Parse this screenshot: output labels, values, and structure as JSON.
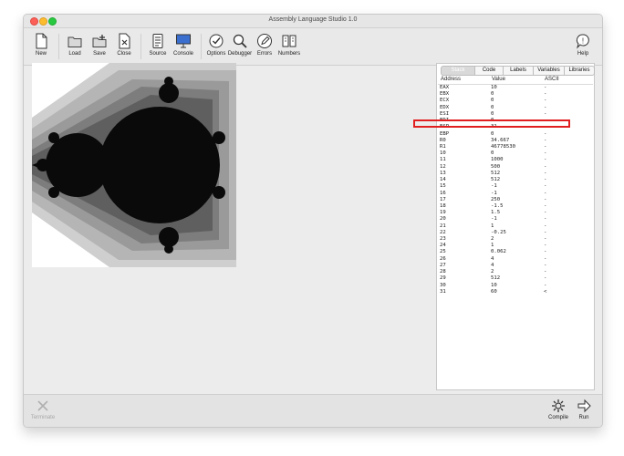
{
  "window": {
    "title": "Assembly Language Studio 1.0"
  },
  "toolbar": {
    "new": "New",
    "load": "Load",
    "save": "Save",
    "close": "Close",
    "source": "Source",
    "console": "Console",
    "options": "Options",
    "debugger": "Debugger",
    "errors": "Errors",
    "numbers": "Numbers",
    "help": "Help"
  },
  "panel": {
    "tabs": [
      "Stack",
      "Code",
      "Labels",
      "Variables",
      "Libraries"
    ],
    "active_tab": "Stack",
    "columns": {
      "address": "Address",
      "value": "Value",
      "ascii": "ASCII"
    },
    "rows": [
      {
        "address": "EAX",
        "value": "10",
        "ascii": "-"
      },
      {
        "address": "EBX",
        "value": "0",
        "ascii": "-"
      },
      {
        "address": "ECX",
        "value": "0",
        "ascii": "-"
      },
      {
        "address": "EDX",
        "value": "0",
        "ascii": "-"
      },
      {
        "address": "ESI",
        "value": "0",
        "ascii": "-"
      },
      {
        "address": "EDI",
        "value": "0",
        "ascii": "-"
      },
      {
        "address": "ESP",
        "value": "31",
        "ascii": "-"
      },
      {
        "address": "EBP",
        "value": "0",
        "ascii": "-"
      },
      {
        "address": "R0",
        "value": "34.667",
        "ascii": "-"
      },
      {
        "address": "R1",
        "value": "46778530",
        "ascii": "-"
      },
      {
        "address": "10",
        "value": "0",
        "ascii": "-"
      },
      {
        "address": "11",
        "value": "1000",
        "ascii": "-"
      },
      {
        "address": "12",
        "value": "500",
        "ascii": "-"
      },
      {
        "address": "13",
        "value": "512",
        "ascii": "-"
      },
      {
        "address": "14",
        "value": "512",
        "ascii": "-"
      },
      {
        "address": "15",
        "value": "-1",
        "ascii": "-"
      },
      {
        "address": "16",
        "value": "-1",
        "ascii": "-"
      },
      {
        "address": "17",
        "value": "250",
        "ascii": "-"
      },
      {
        "address": "18",
        "value": "-1.5",
        "ascii": "-"
      },
      {
        "address": "19",
        "value": "1.5",
        "ascii": "-"
      },
      {
        "address": "20",
        "value": "-1",
        "ascii": "-"
      },
      {
        "address": "21",
        "value": "1",
        "ascii": "-"
      },
      {
        "address": "22",
        "value": "-0.25",
        "ascii": "-"
      },
      {
        "address": "23",
        "value": "2",
        "ascii": "-"
      },
      {
        "address": "24",
        "value": "1",
        "ascii": "-"
      },
      {
        "address": "25",
        "value": "0.062",
        "ascii": "-"
      },
      {
        "address": "26",
        "value": "4",
        "ascii": "-"
      },
      {
        "address": "27",
        "value": "4",
        "ascii": "-"
      },
      {
        "address": "28",
        "value": "2",
        "ascii": "-"
      },
      {
        "address": "29",
        "value": "512",
        "ascii": "-"
      },
      {
        "address": "30",
        "value": "10",
        "ascii": "-"
      },
      {
        "address": "31",
        "value": "60",
        "ascii": "<"
      }
    ],
    "highlighted_row": "R0",
    "highlight_color": "#e02020"
  },
  "bottom": {
    "terminate": "Terminate",
    "compile": "Compile",
    "run": "Run"
  },
  "icons": {
    "new": "new-document-icon",
    "load": "folder-icon",
    "save": "save-folder-icon",
    "close": "close-document-icon",
    "source": "source-icon",
    "console": "console-monitor-icon",
    "options": "checkmark-circle-icon",
    "debugger": "magnifier-icon",
    "errors": "pencil-icon",
    "numbers": "book-icon",
    "help": "help-bubble-icon",
    "terminate": "x-icon",
    "compile": "gear-icon",
    "run": "arrow-right-icon"
  }
}
